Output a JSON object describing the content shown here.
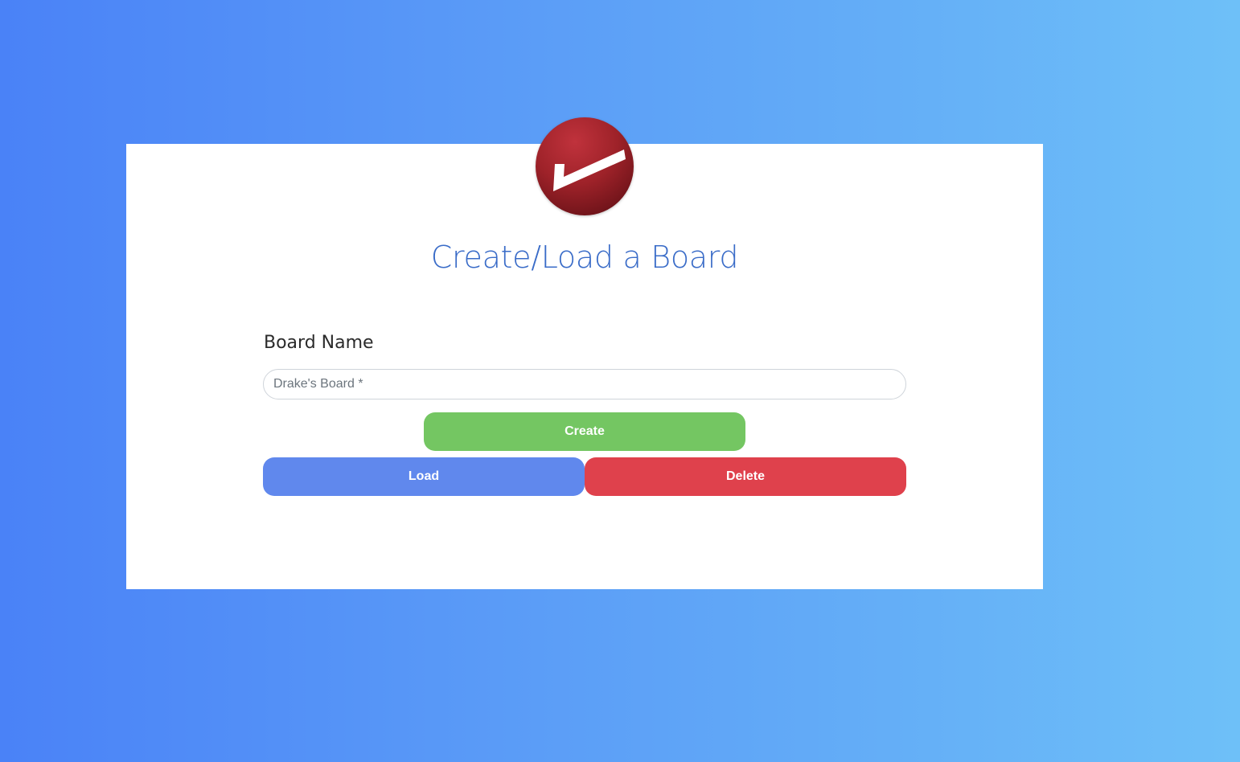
{
  "app": {
    "title": "Create/Load a Board",
    "logo_icon": "checkmark-icon"
  },
  "form": {
    "label": "Board Name",
    "input_value": "",
    "input_placeholder": "Drake's Board *"
  },
  "buttons": {
    "create_label": "Create",
    "load_label": "Load",
    "delete_label": "Delete"
  },
  "colors": {
    "background_start": "#4a82f7",
    "background_end": "#6ec0f8",
    "title": "#3a6cc8",
    "create": "#74c662",
    "load": "#6088ed",
    "delete": "#df414c",
    "logo": "#9e2229"
  }
}
